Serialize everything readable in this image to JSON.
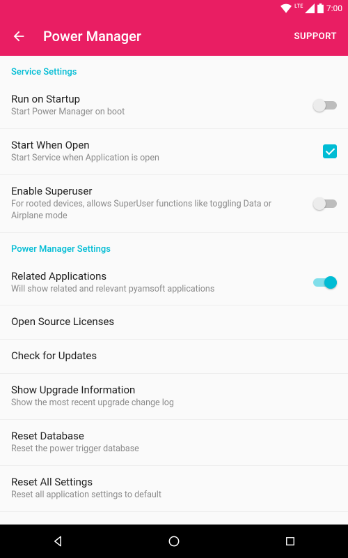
{
  "status": {
    "time": "7:00",
    "lte": "LTE"
  },
  "appbar": {
    "title": "Power Manager",
    "support": "SUPPORT"
  },
  "sections": {
    "service": {
      "header": "Service Settings"
    },
    "pm": {
      "header": "Power Manager Settings"
    }
  },
  "settings": {
    "runStartup": {
      "title": "Run on Startup",
      "sub": "Start Power Manager on boot"
    },
    "startOpen": {
      "title": "Start When Open",
      "sub": "Start Service when Application is open"
    },
    "superuser": {
      "title": "Enable Superuser",
      "sub": "For rooted devices, allows SuperUser functions like toggling Data or Airplane mode"
    },
    "related": {
      "title": "Related Applications",
      "sub": "Will show related and relevant pyamsoft applications"
    },
    "licenses": {
      "title": "Open Source Licenses"
    },
    "updates": {
      "title": "Check for Updates"
    },
    "upgrade": {
      "title": "Show Upgrade Information",
      "sub": "Show the most recent upgrade change log"
    },
    "resetDb": {
      "title": "Reset Database",
      "sub": "Reset the power trigger database"
    },
    "resetAll": {
      "title": "Reset All Settings",
      "sub": "Reset all application settings to default"
    }
  }
}
